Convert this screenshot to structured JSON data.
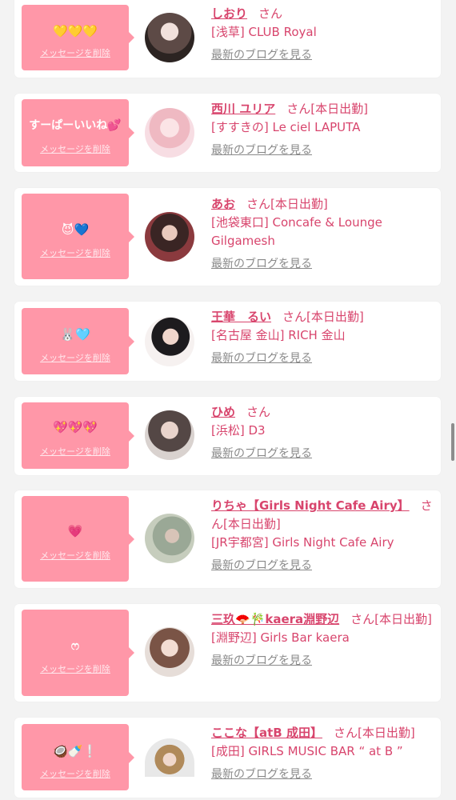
{
  "delete_label": "メッセージを削除",
  "blog_label": "最新のブログを見る",
  "san_suffix": "さん",
  "colors": {
    "bubble": "#ff97a8",
    "accent": "#d8456d",
    "background": "#f3f3f3"
  },
  "items": [
    {
      "message": "💛💛💛",
      "name": "しおり",
      "extra": "",
      "shop": "[浅草] CLUB Royal"
    },
    {
      "message": "すーぱーいいね💕",
      "name": "西川 ユリア",
      "extra": "[本日出勤]",
      "shop": "[すすきの] Le ciel LAPUTA"
    },
    {
      "message": "😈💙",
      "name": "あお",
      "extra": "[本日出勤]",
      "shop": "[池袋東口] Concafe & Lounge Gilgamesh"
    },
    {
      "message": "🐰🩵",
      "name": "王華　るい",
      "extra": "[本日出勤]",
      "shop": "[名古屋 金山] RICH 金山"
    },
    {
      "message": "💖💖💖",
      "name": "ひめ",
      "extra": "",
      "shop": "[浜松] D3"
    },
    {
      "message": "💗",
      "name": "りちゃ【Girls Night Cafe Airy】",
      "extra": "[本日出勤]",
      "shop": "[JR宇都宮] Girls Night Cafe Airy"
    },
    {
      "message": "ෆ",
      "name": "三玖🪭🎋kaera淵野辺",
      "extra": "[本日出勤]",
      "shop": "[淵野辺] Girls Bar kaera"
    },
    {
      "message": "🥥🍼❕",
      "name": "ここな【atB 成田】",
      "extra": "[本日出勤]",
      "shop": "[成田] GIRLS MUSIC BAR “ at B ”"
    }
  ]
}
